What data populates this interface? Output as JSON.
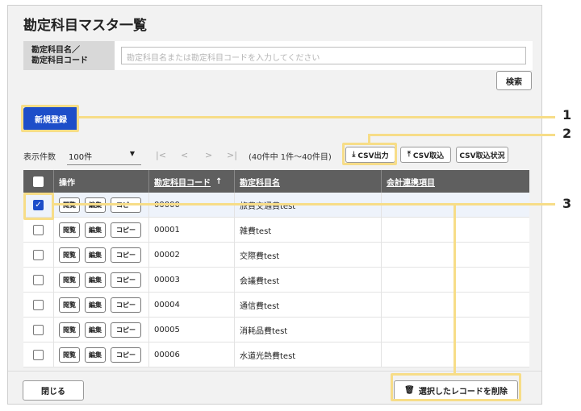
{
  "page": {
    "title": "勘定科目マスタ一覧"
  },
  "search": {
    "label_line1": "勘定科目名／",
    "label_line2": "勘定科目コード",
    "placeholder": "勘定科目名または勘定科目コードを入力してください",
    "search_button": "検索"
  },
  "actions": {
    "new_button": "新規登録",
    "csv_export": "CSV出力",
    "csv_import": "CSV取込",
    "csv_status": "CSV取込状況"
  },
  "pager": {
    "label": "表示件数",
    "per_page": "100件",
    "first": "|<",
    "prev": "<",
    "next": ">",
    "last": ">|",
    "range_text": "(40件中 1件〜40件目)"
  },
  "table": {
    "headers": {
      "ops": "操作",
      "code": "勘定科目コード",
      "sort_arrow": "↑",
      "name": "勘定科目名",
      "link": "会計連携項目"
    },
    "row_buttons": {
      "view": "閲覧",
      "edit": "編集",
      "copy": "コピー"
    },
    "rows": [
      {
        "code": "00000",
        "name": "旅費交通費test",
        "selected": true
      },
      {
        "code": "00001",
        "name": "雑費test",
        "selected": false
      },
      {
        "code": "00002",
        "name": "交際費test",
        "selected": false
      },
      {
        "code": "00003",
        "name": "会議費test",
        "selected": false
      },
      {
        "code": "00004",
        "name": "通信費test",
        "selected": false
      },
      {
        "code": "00005",
        "name": "消耗品費test",
        "selected": false
      },
      {
        "code": "00006",
        "name": "水道光熱費test",
        "selected": false
      }
    ]
  },
  "footer": {
    "close_button": "閉じる",
    "delete_button": "選択したレコードを削除"
  },
  "callouts": [
    "1",
    "2",
    "3"
  ],
  "colors": {
    "primary": "#1d4ec9",
    "highlight": "#f7dd88",
    "header_bg": "#5f5f5f"
  }
}
